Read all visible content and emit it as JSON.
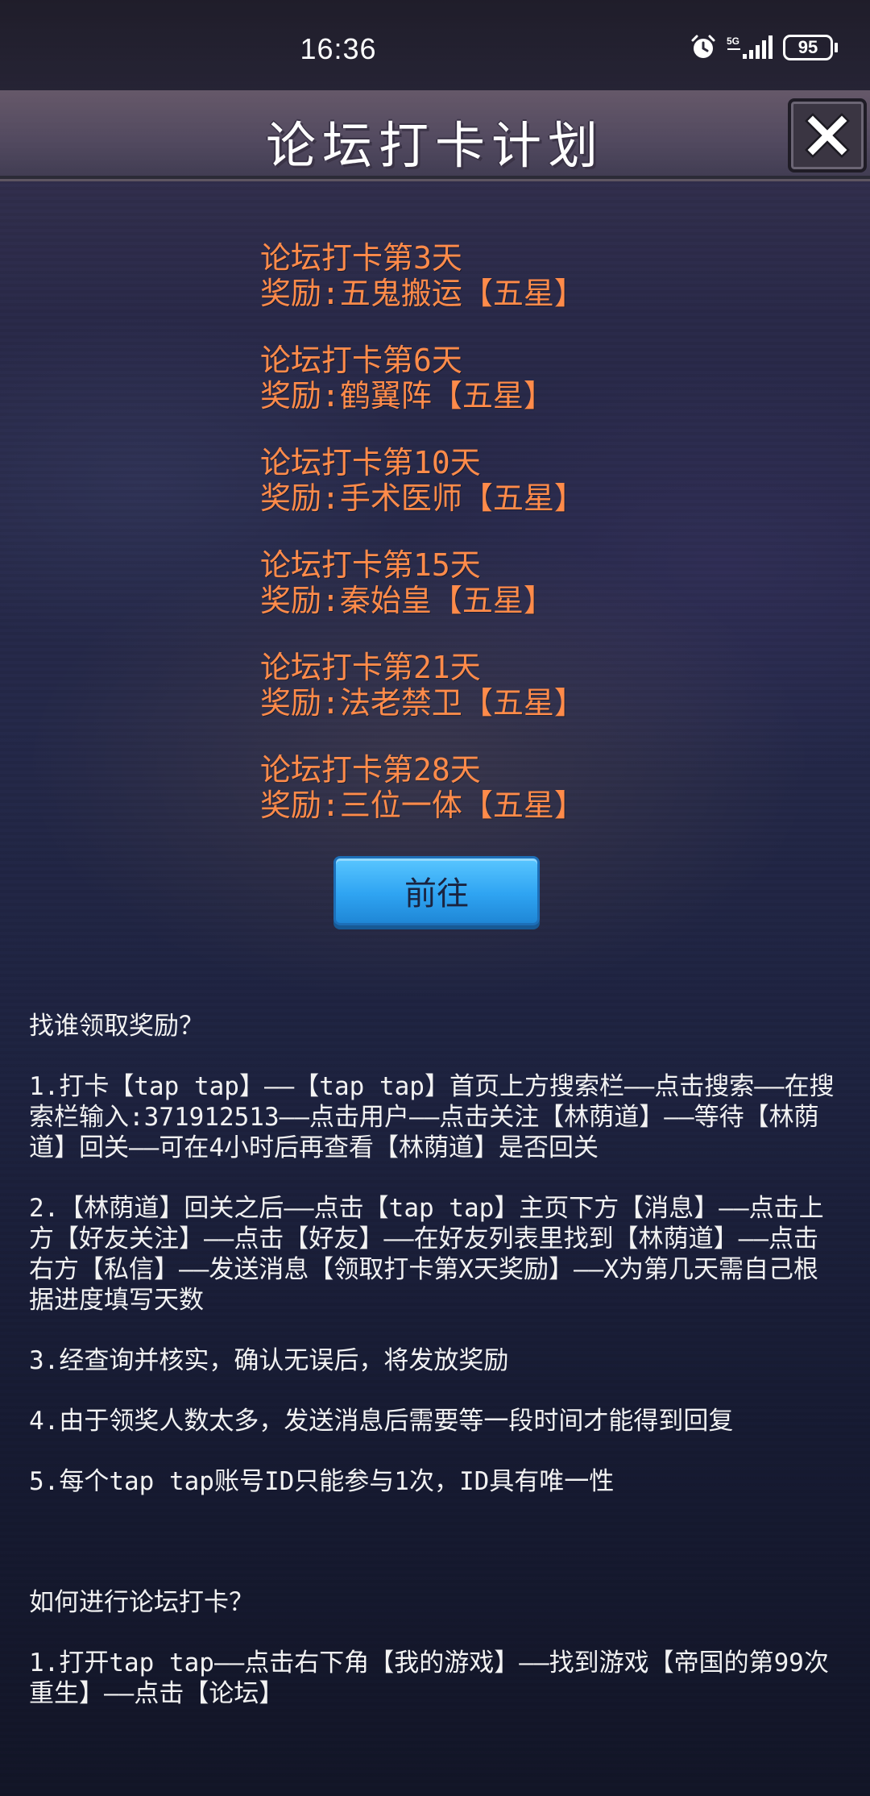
{
  "status_bar": {
    "time": "16:36",
    "battery": "95",
    "icons": [
      "alarm-icon",
      "signal-5g-icon",
      "battery-icon"
    ]
  },
  "header": {
    "title": "论坛打卡计划",
    "close_icon": "close-icon"
  },
  "rewards": [
    {
      "day": "论坛打卡第3天",
      "reward": "奖励:五鬼搬运【五星】"
    },
    {
      "day": "论坛打卡第6天",
      "reward": "奖励:鹤翼阵【五星】"
    },
    {
      "day": "论坛打卡第10天",
      "reward": "奖励:手术医师【五星】"
    },
    {
      "day": "论坛打卡第15天",
      "reward": "奖励:秦始皇【五星】"
    },
    {
      "day": "论坛打卡第21天",
      "reward": "奖励:法老禁卫【五星】"
    },
    {
      "day": "论坛打卡第28天",
      "reward": "奖励:三位一体【五星】"
    }
  ],
  "go_button": {
    "label": "前往"
  },
  "instructions": {
    "claim_heading": "找谁领取奖励？",
    "claim_steps": [
      "1.打卡【tap tap】——【tap tap】首页上方搜索栏——点击搜索——在搜索栏输入:371912513——点击用户——点击关注【林荫道】——等待【林荫道】回关——可在4小时后再查看【林荫道】是否回关",
      "2.【林荫道】回关之后——点击【tap tap】主页下方【消息】——点击上方【好友关注】——点击【好友】——在好友列表里找到【林荫道】——点击右方【私信】——发送消息【领取打卡第X天奖励】——X为第几天需自己根据进度填写天数",
      "3.经查询并核实，确认无误后，将发放奖励",
      "4.由于领奖人数太多，发送消息后需要等一段时间才能得到回复",
      "5.每个tap tap账号ID只能参与1次，ID具有唯一性"
    ],
    "checkin_heading": "如何进行论坛打卡？",
    "checkin_steps": [
      "1.打开tap tap——点击右下角【我的游戏】——找到游戏【帝国的第99次重生】——点击【论坛】"
    ]
  },
  "colors": {
    "reward_text": "#ff8b4a",
    "button_blue": "#2fa4f2",
    "body_text": "#f2f2f2"
  }
}
